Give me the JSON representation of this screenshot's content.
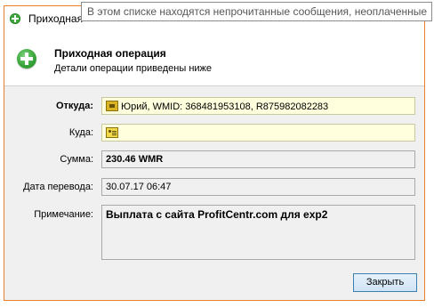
{
  "window": {
    "title": "Приходная операция"
  },
  "tooltip": {
    "text": "В этом списке находятся непрочитанные сообщения, неоплаченные"
  },
  "header": {
    "title": "Приходная операция",
    "subtitle": "Детали операции приведены ниже"
  },
  "fields": {
    "from": {
      "label": "Откуда:",
      "value": "Юрий, WMID: 368481953108, R875982082283"
    },
    "to": {
      "label": "Куда:",
      "value": ""
    },
    "amount": {
      "label": "Сумма:",
      "value": "230.46 WMR"
    },
    "date": {
      "label": "Дата перевода:",
      "value": "30.07.17 06:47"
    },
    "note": {
      "label": "Примечание:",
      "value": "Выплата с сайта ProfitCentr.com для exp2"
    }
  },
  "buttons": {
    "close_label": "Закрыть"
  }
}
